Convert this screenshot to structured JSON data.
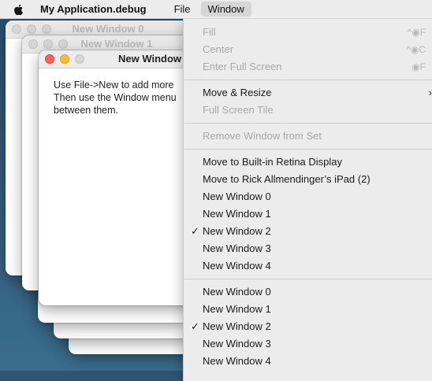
{
  "menubar": {
    "app_name": "My Application.debug",
    "items": [
      "File",
      "Window"
    ]
  },
  "windows": {
    "w0_title": "New Window 0",
    "w1_title": "New Window 1",
    "active_title": "New Window",
    "body_lines": [
      "Use File->New to add more",
      "Then use the Window menu",
      "between them."
    ]
  },
  "menu": {
    "fill": "Fill",
    "fill_shortcut": "^◉F",
    "center": "Center",
    "center_shortcut": "^◉C",
    "enter_full_screen": "Enter Full Screen",
    "enter_full_screen_shortcut": "◉F",
    "move_resize": "Move & Resize",
    "full_screen_tile": "Full Screen Tile",
    "remove_window": "Remove Window from Set",
    "move_retina": "Move to Built-in Retina Display",
    "move_ipad": "Move to Rick Allmendinger’s iPad (2)",
    "group1": [
      "New Window 0",
      "New Window 1",
      "New Window 2",
      "New Window 3",
      "New Window 4"
    ],
    "group2": [
      "New Window 0",
      "New Window 1",
      "New Window 2",
      "New Window 3",
      "New Window 4"
    ],
    "checked_index": 2,
    "check_mark": "✓"
  }
}
